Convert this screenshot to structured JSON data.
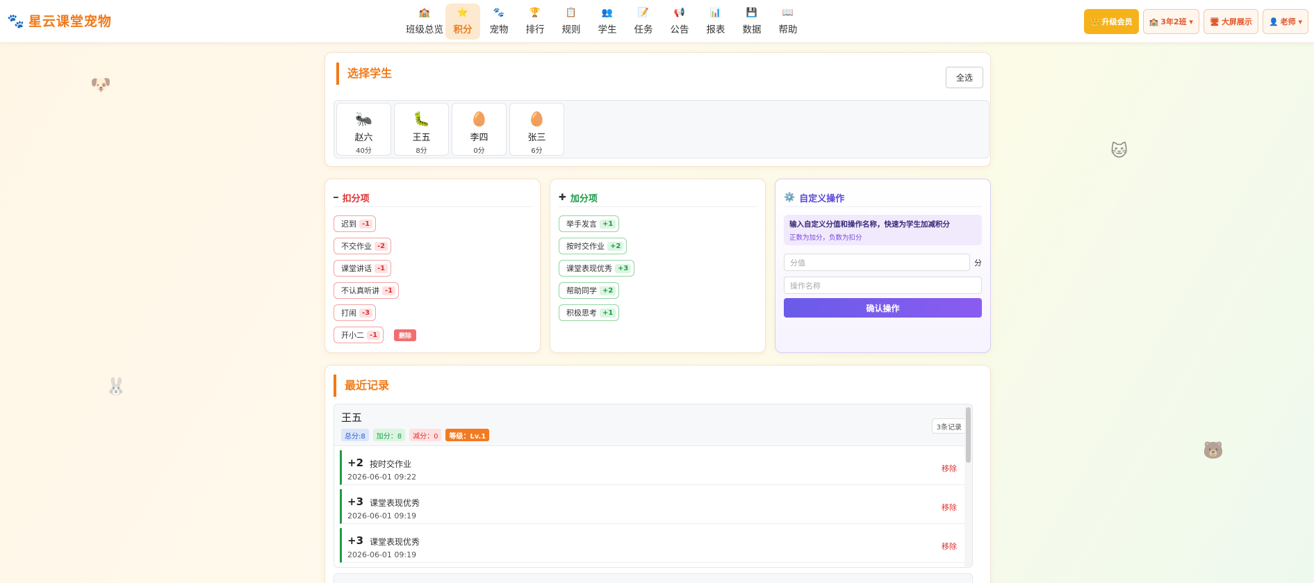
{
  "app": {
    "title": "星云课堂宠物",
    "logo_icon": "🐾"
  },
  "nav": [
    {
      "icon": "🏫",
      "label": "班级总览",
      "active": false
    },
    {
      "icon": "⭐",
      "label": "积分",
      "active": true
    },
    {
      "icon": "🐾",
      "label": "宠物",
      "active": false
    },
    {
      "icon": "🏆",
      "label": "排行",
      "active": false
    },
    {
      "icon": "📋",
      "label": "规则",
      "active": false
    },
    {
      "icon": "👥",
      "label": "学生",
      "active": false
    },
    {
      "icon": "📝",
      "label": "任务",
      "active": false
    },
    {
      "icon": "📢",
      "label": "公告",
      "active": false
    },
    {
      "icon": "📊",
      "label": "报表",
      "active": false
    },
    {
      "icon": "💾",
      "label": "数据",
      "active": false
    },
    {
      "icon": "📖",
      "label": "帮助",
      "active": false
    }
  ],
  "tools": {
    "upgrade": {
      "icon": "👑",
      "label": "升级会员"
    },
    "class_select": {
      "icon": "🏫",
      "label": "3年2班 ▾"
    },
    "big_screen": {
      "icon": "🖥",
      "label": "大屏展示"
    },
    "user": {
      "icon": "👤",
      "label": "老师 ▾"
    }
  },
  "select_students": {
    "title": "选择学生",
    "select_all": "全选",
    "students": [
      {
        "avatar": "🐜",
        "name": "赵六",
        "score": "40分"
      },
      {
        "avatar": "🐛",
        "name": "王五",
        "score": "8分"
      },
      {
        "avatar": "🥚",
        "name": "李四",
        "score": "0分"
      },
      {
        "avatar": "🥚",
        "name": "张三",
        "score": "6分"
      }
    ]
  },
  "deduct": {
    "icon": "━",
    "title": "扣分项",
    "items": [
      {
        "label": "迟到",
        "value": "-1"
      },
      {
        "label": "不交作业",
        "value": "-2"
      },
      {
        "label": "课堂讲话",
        "value": "-1"
      },
      {
        "label": "不认真听讲",
        "value": "-1"
      },
      {
        "label": "打闹",
        "value": "-3"
      },
      {
        "label": "开小二",
        "value": "-1"
      }
    ],
    "delete_label": "删除"
  },
  "add": {
    "icon": "✚",
    "title": "加分项",
    "items": [
      {
        "label": "举手发言",
        "value": "+1"
      },
      {
        "label": "按时交作业",
        "value": "+2"
      },
      {
        "label": "课堂表现优秀",
        "value": "+3"
      },
      {
        "label": "帮助同学",
        "value": "+2"
      },
      {
        "label": "积极思考",
        "value": "+1"
      }
    ]
  },
  "custom": {
    "icon": "⚙️",
    "title": "自定义操作",
    "info_line1": "输入自定义分值和操作名称，快速为学生加减积分",
    "info_line2": "正数为加分，负数为扣分",
    "score_placeholder": "分值",
    "score_unit": "分",
    "name_placeholder": "操作名称",
    "confirm_label": "确认操作"
  },
  "records": {
    "title": "最近记录",
    "student": {
      "name": "王五",
      "total": "总分:8",
      "add": "加分：8",
      "sub": "减分：0",
      "level": "等级：Lv.1",
      "count": "3条记录"
    },
    "rows": [
      {
        "points": "+2",
        "action": "按时交作业",
        "time": "2026-06-01 09:22",
        "remove": "移除"
      },
      {
        "points": "+3",
        "action": "课堂表现优秀",
        "time": "2026-06-01 09:19",
        "remove": "移除"
      },
      {
        "points": "+3",
        "action": "课堂表现优秀",
        "time": "2026-06-01 09:19",
        "remove": "移除"
      }
    ]
  },
  "colors": {
    "accent": "#f07a1a",
    "negative": "#e03131",
    "positive": "#1e9b46",
    "purple": "#6a5be8"
  }
}
